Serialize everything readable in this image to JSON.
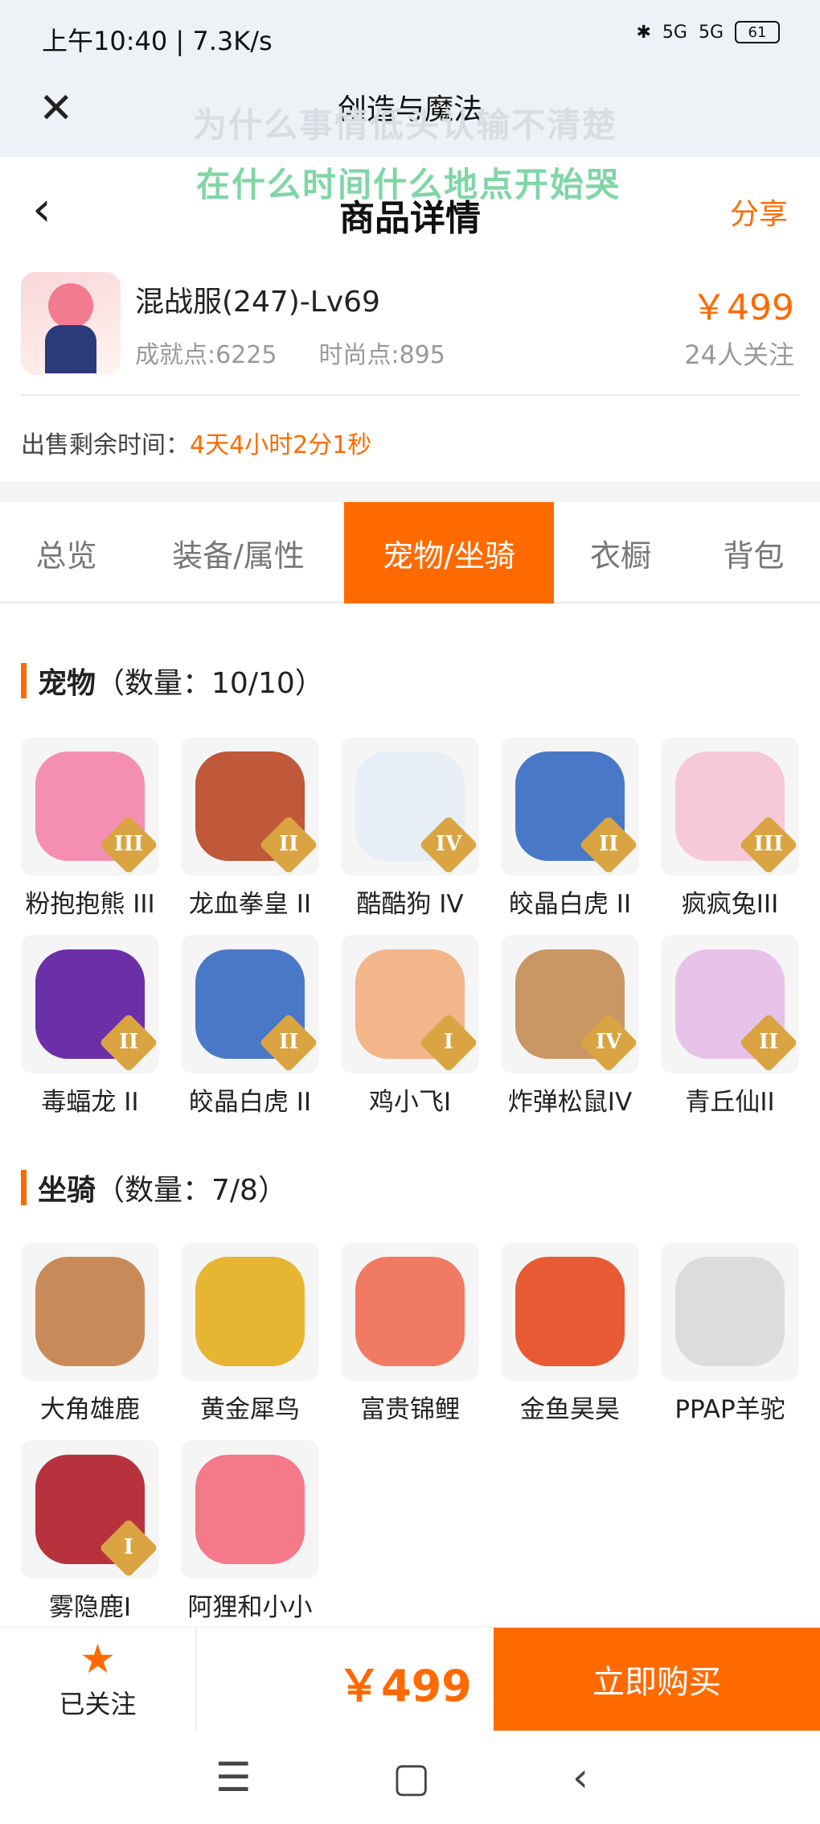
{
  "status": {
    "time": "上午10:40 | 7.3K/s",
    "signal1": "5G",
    "signal2": "5G",
    "battery": "61"
  },
  "topbar": {
    "title": "创造与魔法",
    "overlay_line1": "为什么事情低头认输不清楚",
    "overlay_line2": "在什么时间什么地点开始哭"
  },
  "header": {
    "title": "商品详情",
    "share": "分享"
  },
  "product": {
    "name": "混战服(247)-Lv69",
    "achievement": "成就点:6225",
    "fashion": "时尚点:895",
    "price": "￥499",
    "followers": "24人关注"
  },
  "sale": {
    "label": "出售剩余时间：",
    "countdown": "4天4小时2分1秒"
  },
  "tabs": [
    {
      "label": "总览"
    },
    {
      "label": "装备/属性"
    },
    {
      "label": "宠物/坐骑"
    },
    {
      "label": "衣橱"
    },
    {
      "label": "背包"
    }
  ],
  "pets": {
    "title": "宠物",
    "count": "（数量：10/10）",
    "items": [
      {
        "name": "粉抱抱熊 III",
        "rank": "III",
        "color": "#f48fb1"
      },
      {
        "name": "龙血拳皇 II",
        "rank": "II",
        "color": "#c0583a"
      },
      {
        "name": "酷酷狗 IV",
        "rank": "IV",
        "color": "#e8eef5"
      },
      {
        "name": "皎晶白虎 II",
        "rank": "II",
        "color": "#4a78c8"
      },
      {
        "name": "疯疯兔III",
        "rank": "III",
        "color": "#f6c9d8"
      },
      {
        "name": "毒蝠龙 II",
        "rank": "II",
        "color": "#6b2fa8"
      },
      {
        "name": "皎晶白虎 II",
        "rank": "II",
        "color": "#4a78c8"
      },
      {
        "name": "鸡小飞I",
        "rank": "I",
        "color": "#f3b58a"
      },
      {
        "name": "炸弹松鼠IV",
        "rank": "IV",
        "color": "#c99763"
      },
      {
        "name": "青丘仙II",
        "rank": "II",
        "color": "#e7c2e8"
      }
    ]
  },
  "mounts": {
    "title": "坐骑",
    "count": "（数量：7/8）",
    "items": [
      {
        "name": "大角雄鹿",
        "rank": "",
        "color": "#c98a5a"
      },
      {
        "name": "黄金犀鸟",
        "rank": "",
        "color": "#e6b532"
      },
      {
        "name": "富贵锦鲤",
        "rank": "",
        "color": "#f07a62"
      },
      {
        "name": "金鱼昊昊",
        "rank": "",
        "color": "#e85a34"
      },
      {
        "name": "PPAP羊驼",
        "rank": "",
        "color": "#dcdcdc"
      },
      {
        "name": "雾隐鹿I",
        "rank": "I",
        "color": "#b8323e"
      },
      {
        "name": "阿狸和小小",
        "rank": "",
        "color": "#f47a8a"
      }
    ]
  },
  "bottom": {
    "follow_label": "已关注",
    "price": "￥499",
    "buy": "立即购买"
  }
}
